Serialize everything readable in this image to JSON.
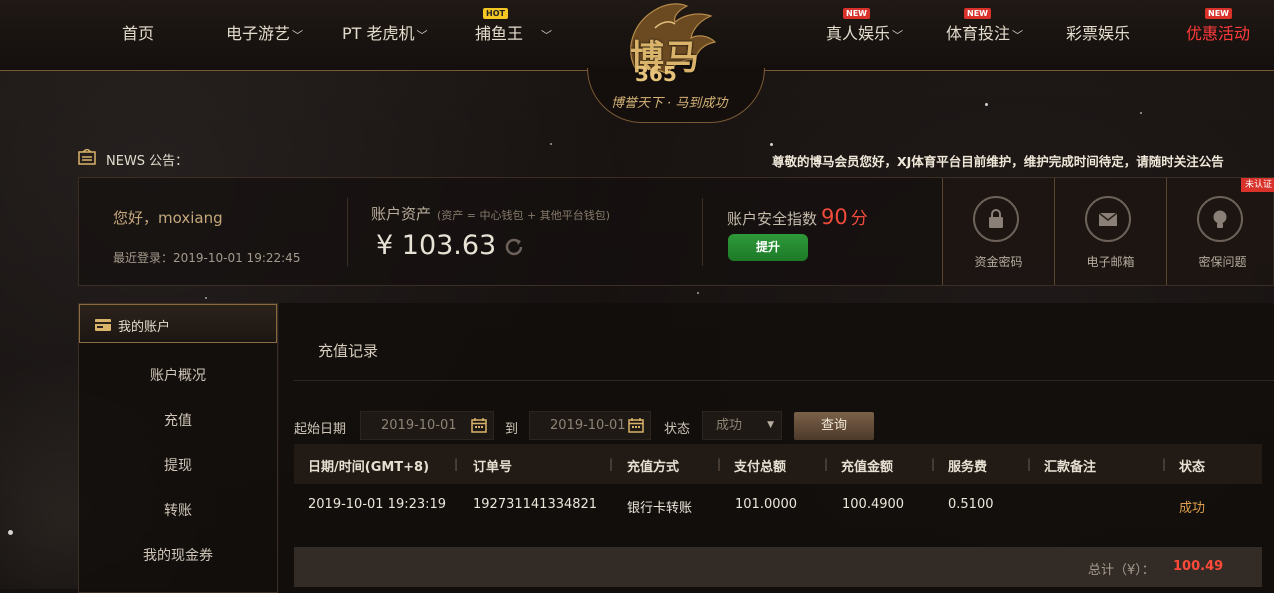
{
  "nav": {
    "items": [
      {
        "label": "首页",
        "has_menu": false,
        "tag": ""
      },
      {
        "label": "电子游艺",
        "has_menu": true,
        "tag": ""
      },
      {
        "label": "PT 老虎机",
        "has_menu": true,
        "tag": ""
      },
      {
        "label": "捕鱼王",
        "has_menu": true,
        "tag": "HOT"
      },
      {
        "label": "真人娱乐",
        "has_menu": true,
        "tag": "NEW"
      },
      {
        "label": "体育投注",
        "has_menu": true,
        "tag": "NEW"
      },
      {
        "label": "彩票娱乐",
        "has_menu": false,
        "tag": ""
      },
      {
        "label": "优惠活动",
        "has_menu": false,
        "tag": "NEW"
      }
    ]
  },
  "logo": {
    "brand": "博马",
    "number": "365",
    "slogan": "博誉天下 · 马到成功"
  },
  "news": {
    "label": "NEWS 公告：",
    "text": "尊敬的博马会员您好，XJ体育平台目前维护，维护完成时间待定，请随时关注公告"
  },
  "account": {
    "greeting": "您好，moxiang",
    "last_login": "最近登录：2019-10-01 19:22:45",
    "assets_label": "账户资产",
    "assets_sub": "(资产 = 中心钱包 + 其他平台钱包)",
    "assets_value": "¥ 103.63",
    "security_label": "账户安全指数",
    "security_score": "90",
    "security_unit": "分",
    "upgrade_label": "提升",
    "security_items": [
      {
        "label": "资金密码",
        "icon": "lock-icon"
      },
      {
        "label": "电子邮箱",
        "icon": "mail-icon"
      },
      {
        "label": "密保问题",
        "icon": "lightbulb-icon"
      }
    ],
    "unverified_badge": "未认证"
  },
  "sidebar": {
    "header": "我的账户",
    "items": [
      "账户概况",
      "充值",
      "提现",
      "转账",
      "我的现金券"
    ]
  },
  "main": {
    "title": "充值记录",
    "filters": {
      "start_label": "起始日期",
      "start_value": "2019-10-01",
      "to_label": "到",
      "end_value": "2019-10-01",
      "status_label": "状态",
      "status_value": "成功",
      "query_label": "查询"
    },
    "table": {
      "headers": [
        "日期/时间(GMT+8)",
        "订单号",
        "充值方式",
        "支付总额",
        "充值金额",
        "服务费",
        "汇款备注",
        "状态"
      ],
      "rows": [
        [
          "2019-10-01 19:23:19",
          "192731141334821",
          "银行卡转账",
          "101.0000",
          "100.4900",
          "0.5100",
          "",
          "成功"
        ]
      ]
    },
    "total_label": "总计（¥）：",
    "total_value": "100.49"
  },
  "colors": {
    "accent_gold": "#d9b36a",
    "success_green": "#1d7a28",
    "alert_red": "#f04b3a",
    "status_orange": "#e0a14d"
  }
}
